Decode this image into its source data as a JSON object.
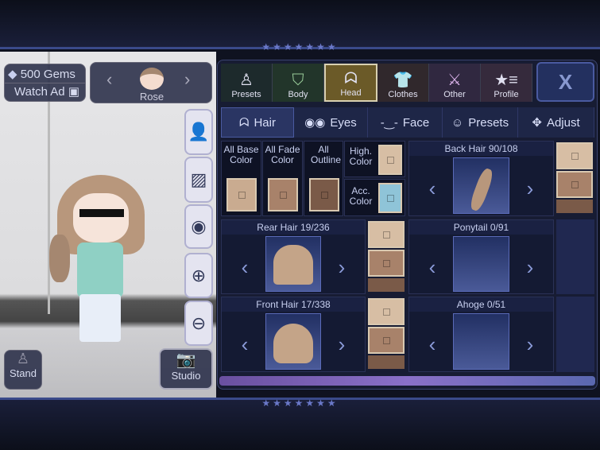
{
  "currency": {
    "gems": "500 Gems",
    "watch_ad": "Watch Ad"
  },
  "character": {
    "name": "Rose"
  },
  "left_buttons": {
    "stand": "Stand",
    "studio": "Studio"
  },
  "top_tabs": [
    {
      "label": "Presets"
    },
    {
      "label": "Body"
    },
    {
      "label": "Head"
    },
    {
      "label": "Clothes"
    },
    {
      "label": "Other"
    },
    {
      "label": "Profile"
    }
  ],
  "close_label": "X",
  "sub_tabs": [
    {
      "label": "Hair"
    },
    {
      "label": "Eyes"
    },
    {
      "label": "Face"
    },
    {
      "label": "Presets"
    },
    {
      "label": "Adjust"
    }
  ],
  "colors": {
    "all_base": "All Base Color",
    "all_fade": "All Fade Color",
    "all_outline": "All Outline",
    "high": "High. Color",
    "acc": "Acc. Color"
  },
  "slots": {
    "back_hair": "Back Hair 90/108",
    "rear_hair": "Rear Hair 19/236",
    "ponytail": "Ponytail 0/91",
    "front_hair": "Front Hair 17/338",
    "ahoge": "Ahoge 0/51"
  },
  "palette": {
    "base": "#c9ab90",
    "fade": "#a8826a",
    "outline": "#7a5a48",
    "accent": "#8fc4d8",
    "active_tab": "#6b5a28"
  }
}
